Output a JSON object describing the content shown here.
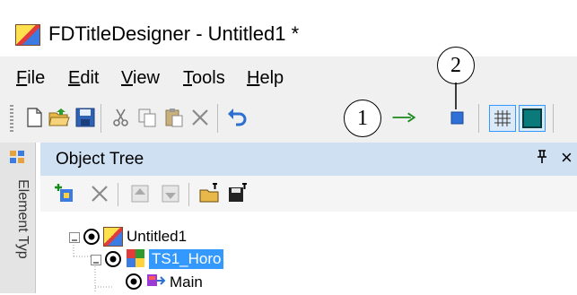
{
  "window": {
    "title": "FDTitleDesigner - Untitled1 *"
  },
  "menu": [
    "File",
    "Edit",
    "View",
    "Tools",
    "Help"
  ],
  "toolbar": {
    "buttons": [
      "new-icon",
      "open-icon",
      "save-icon",
      "cut-icon",
      "copy-icon",
      "paste-icon",
      "delete-icon",
      "undo-icon",
      "arrow-icon",
      "square-icon",
      "grid-icon",
      "frame-icon"
    ]
  },
  "callouts": {
    "one": "1",
    "two": "2"
  },
  "side_panel": {
    "label": "Element Typ"
  },
  "object_tree": {
    "title": "Object Tree",
    "pin_glyph": "ᵖ",
    "close_glyph": "×",
    "nodes": [
      {
        "label": "Untitled1",
        "level": 0,
        "expanded": true,
        "selected": false
      },
      {
        "label": "TS1_Horo",
        "level": 1,
        "expanded": true,
        "selected": true
      },
      {
        "label": "Main",
        "level": 2,
        "expanded": false,
        "selected": false
      }
    ]
  },
  "colors": {
    "accent": "#cfe0f3",
    "selection": "#3399ff",
    "arrow": "#1a8a1a",
    "square": "#2f6fd6"
  }
}
